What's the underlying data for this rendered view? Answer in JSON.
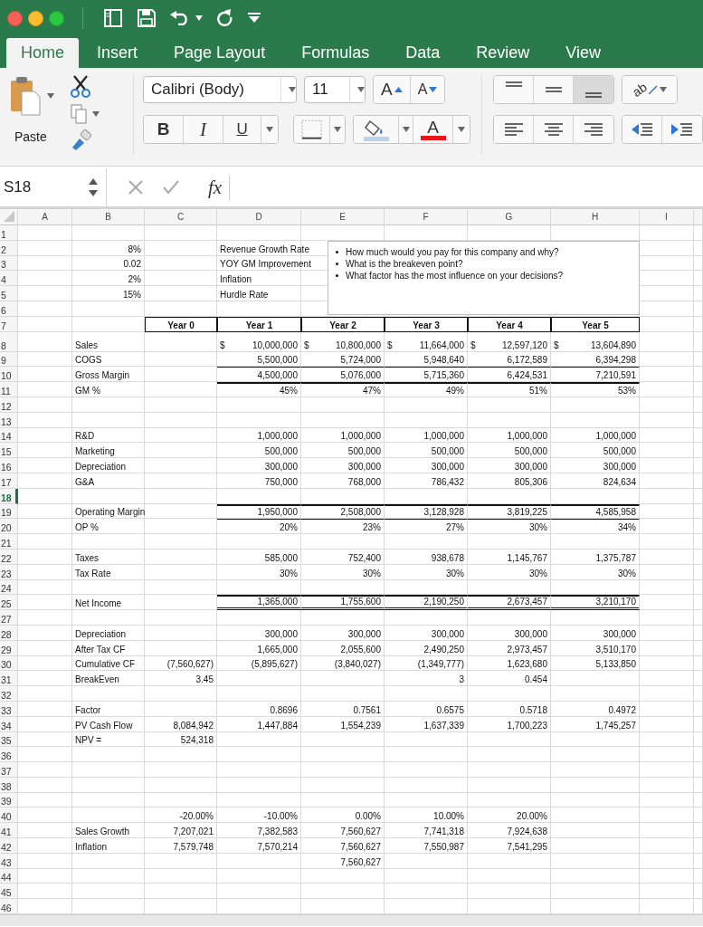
{
  "tabs": [
    {
      "label": "Home",
      "selected": true
    },
    {
      "label": "Insert",
      "selected": false
    },
    {
      "label": "Page Layout",
      "selected": false
    },
    {
      "label": "Formulas",
      "selected": false
    },
    {
      "label": "Data",
      "selected": false
    },
    {
      "label": "Review",
      "selected": false
    },
    {
      "label": "View",
      "selected": false
    }
  ],
  "ribbon": {
    "paste_label": "Paste",
    "font_name": "Calibri (Body)",
    "font_size": "11",
    "grow_font": "A",
    "shrink_font": "A",
    "bold": "B",
    "italic": "I",
    "underline": "U",
    "font_color": "A",
    "orientation": "ab",
    "vertical_alignment": [
      {
        "selected": false
      },
      {
        "selected": false
      },
      {
        "selected": true
      }
    ]
  },
  "formula_bar": {
    "name_box": "S18",
    "function_label": "fx"
  },
  "sheet": {
    "columns": [
      "A",
      "B",
      "C",
      "D",
      "E",
      "F",
      "G",
      "H",
      "I"
    ],
    "text_box": {
      "bullets": [
        "How much would you pay for this company and why?",
        "What is the breakeven point?",
        "What factor has the most influence on your decisions?"
      ]
    },
    "rows": [
      {
        "number": "1",
        "selected": false
      },
      {
        "number": "2",
        "selected": false,
        "cells": [
          null,
          {
            "kind": "number",
            "text": "8%"
          },
          null,
          {
            "kind": "label",
            "text": "Revenue Growth Rate"
          }
        ]
      },
      {
        "number": "3",
        "selected": false,
        "cells": [
          null,
          {
            "kind": "number",
            "text": "0.02"
          },
          null,
          {
            "kind": "label",
            "text": "YOY GM Improvement"
          }
        ]
      },
      {
        "number": "4",
        "selected": false,
        "cells": [
          null,
          {
            "kind": "number",
            "text": "2%"
          },
          null,
          {
            "kind": "label",
            "text": "Inflation"
          }
        ]
      },
      {
        "number": "5",
        "selected": false,
        "cells": [
          null,
          {
            "kind": "number",
            "text": "15%"
          },
          null,
          {
            "kind": "label",
            "text": "Hurdle Rate"
          }
        ]
      },
      {
        "number": "6",
        "selected": false
      },
      {
        "number": "7",
        "selected": false,
        "cells": [
          null,
          null,
          {
            "kind": "header",
            "text": "Year 0"
          },
          {
            "kind": "header",
            "text": "Year 1"
          },
          {
            "kind": "header",
            "text": "Year 2"
          },
          {
            "kind": "header",
            "text": "Year 3"
          },
          {
            "kind": "header",
            "text": "Year 4"
          },
          {
            "kind": "header",
            "text": "Year 5"
          }
        ]
      },
      {
        "number": "8",
        "selected": false,
        "tall": true,
        "cells": [
          null,
          {
            "kind": "label",
            "text": "Sales"
          },
          null,
          {
            "kind": "currency",
            "symbol": "$",
            "text": "10,000,000"
          },
          {
            "kind": "currency",
            "symbol": "$",
            "text": "10,800,000"
          },
          {
            "kind": "currency",
            "symbol": "$",
            "text": "11,664,000"
          },
          {
            "kind": "currency",
            "symbol": "$",
            "text": "12,597,120"
          },
          {
            "kind": "currency",
            "symbol": "$",
            "text": "13,604,890"
          }
        ]
      },
      {
        "number": "9",
        "selected": false,
        "cells": [
          null,
          {
            "kind": "label",
            "text": "COGS"
          },
          null,
          {
            "kind": "number",
            "text": "5,500,000"
          },
          {
            "kind": "number",
            "text": "5,724,000"
          },
          {
            "kind": "number",
            "text": "5,948,640"
          },
          {
            "kind": "number",
            "text": "6,172,589"
          },
          {
            "kind": "number",
            "text": "6,394,298"
          }
        ]
      },
      {
        "number": "10",
        "selected": false,
        "top_rule": true,
        "cells": [
          null,
          {
            "kind": "label",
            "text": "Gross Margin"
          },
          null,
          {
            "kind": "number",
            "text": "4,500,000"
          },
          {
            "kind": "number",
            "text": "5,076,000"
          },
          {
            "kind": "number",
            "text": "5,715,360"
          },
          {
            "kind": "number",
            "text": "6,424,531"
          },
          {
            "kind": "number",
            "text": "7,210,591"
          }
        ]
      },
      {
        "number": "11",
        "selected": false,
        "top_rule": true,
        "top_rule_thick": true,
        "cells": [
          null,
          {
            "kind": "label",
            "text": "GM %"
          },
          null,
          {
            "kind": "number",
            "text": "45%"
          },
          {
            "kind": "number",
            "text": "47%"
          },
          {
            "kind": "number",
            "text": "49%"
          },
          {
            "kind": "number",
            "text": "51%"
          },
          {
            "kind": "number",
            "text": "53%"
          }
        ]
      },
      {
        "number": "12",
        "selected": false
      },
      {
        "number": "13",
        "selected": false
      },
      {
        "number": "14",
        "selected": false,
        "cells": [
          null,
          {
            "kind": "label",
            "text": "R&D"
          },
          null,
          {
            "kind": "number",
            "text": "1,000,000"
          },
          {
            "kind": "number",
            "text": "1,000,000"
          },
          {
            "kind": "number",
            "text": "1,000,000"
          },
          {
            "kind": "number",
            "text": "1,000,000"
          },
          {
            "kind": "number",
            "text": "1,000,000"
          }
        ]
      },
      {
        "number": "15",
        "selected": false,
        "cells": [
          null,
          {
            "kind": "label",
            "text": "Marketing"
          },
          null,
          {
            "kind": "number",
            "text": "500,000"
          },
          {
            "kind": "number",
            "text": "500,000"
          },
          {
            "kind": "number",
            "text": "500,000"
          },
          {
            "kind": "number",
            "text": "500,000"
          },
          {
            "kind": "number",
            "text": "500,000"
          }
        ]
      },
      {
        "number": "16",
        "selected": false,
        "cells": [
          null,
          {
            "kind": "label",
            "text": "Depreciation"
          },
          null,
          {
            "kind": "number",
            "text": "300,000"
          },
          {
            "kind": "number",
            "text": "300,000"
          },
          {
            "kind": "number",
            "text": "300,000"
          },
          {
            "kind": "number",
            "text": "300,000"
          },
          {
            "kind": "number",
            "text": "300,000"
          }
        ]
      },
      {
        "number": "17",
        "selected": false,
        "cells": [
          null,
          {
            "kind": "label",
            "text": "G&A"
          },
          null,
          {
            "kind": "number",
            "text": "750,000"
          },
          {
            "kind": "number",
            "text": "768,000"
          },
          {
            "kind": "number",
            "text": "786,432"
          },
          {
            "kind": "number",
            "text": "805,306"
          },
          {
            "kind": "number",
            "text": "824,634"
          }
        ]
      },
      {
        "number": "18",
        "selected": true
      },
      {
        "number": "19",
        "selected": false,
        "top_rule": true,
        "top_rule_thick": true,
        "cells": [
          null,
          {
            "kind": "label",
            "text": "Operating Margin"
          },
          null,
          {
            "kind": "number",
            "text": "1,950,000"
          },
          {
            "kind": "number",
            "text": "2,508,000"
          },
          {
            "kind": "number",
            "text": "3,128,928"
          },
          {
            "kind": "number",
            "text": "3,819,225"
          },
          {
            "kind": "number",
            "text": "4,585,958"
          }
        ]
      },
      {
        "number": "20",
        "selected": false,
        "top_rule": true,
        "cells": [
          null,
          {
            "kind": "label",
            "text": "OP %"
          },
          null,
          {
            "kind": "number",
            "text": "20%"
          },
          {
            "kind": "number",
            "text": "23%"
          },
          {
            "kind": "number",
            "text": "27%"
          },
          {
            "kind": "number",
            "text": "30%"
          },
          {
            "kind": "number",
            "text": "34%"
          }
        ]
      },
      {
        "number": "21",
        "selected": false
      },
      {
        "number": "22",
        "selected": false,
        "cells": [
          null,
          {
            "kind": "label",
            "text": "Taxes"
          },
          null,
          {
            "kind": "number",
            "text": "585,000"
          },
          {
            "kind": "number",
            "text": "752,400"
          },
          {
            "kind": "number",
            "text": "938,678"
          },
          {
            "kind": "number",
            "text": "1,145,767"
          },
          {
            "kind": "number",
            "text": "1,375,787"
          }
        ]
      },
      {
        "number": "23",
        "selected": false,
        "cells": [
          null,
          {
            "kind": "label",
            "text": "Tax Rate"
          },
          null,
          {
            "kind": "number",
            "text": "30%"
          },
          {
            "kind": "number",
            "text": "30%"
          },
          {
            "kind": "number",
            "text": "30%"
          },
          {
            "kind": "number",
            "text": "30%"
          },
          {
            "kind": "number",
            "text": "30%"
          }
        ]
      },
      {
        "number": "24",
        "selected": false
      },
      {
        "number": "25",
        "selected": false,
        "top_rule": true,
        "top_rule_thick": true,
        "double_underline": true,
        "cells": [
          null,
          {
            "kind": "label",
            "text": "Net Income"
          },
          null,
          {
            "kind": "number",
            "text": "1,365,000"
          },
          {
            "kind": "number",
            "text": "1,755,600"
          },
          {
            "kind": "number",
            "text": "2,190,250"
          },
          {
            "kind": "number",
            "text": "2,673,457"
          },
          {
            "kind": "number",
            "text": "3,210,170"
          }
        ]
      },
      {
        "number": "27",
        "selected": false
      },
      {
        "number": "28",
        "selected": false,
        "cells": [
          null,
          {
            "kind": "label",
            "text": "Depreciation"
          },
          null,
          {
            "kind": "number",
            "text": "300,000"
          },
          {
            "kind": "number",
            "text": "300,000"
          },
          {
            "kind": "number",
            "text": "300,000"
          },
          {
            "kind": "number",
            "text": "300,000"
          },
          {
            "kind": "number",
            "text": "300,000"
          }
        ]
      },
      {
        "number": "29",
        "selected": false,
        "cells": [
          null,
          {
            "kind": "label",
            "text": "After Tax CF"
          },
          null,
          {
            "kind": "number",
            "text": "1,665,000"
          },
          {
            "kind": "number",
            "text": "2,055,600"
          },
          {
            "kind": "number",
            "text": "2,490,250"
          },
          {
            "kind": "number",
            "text": "2,973,457"
          },
          {
            "kind": "number",
            "text": "3,510,170"
          }
        ]
      },
      {
        "number": "30",
        "selected": false,
        "cells": [
          null,
          {
            "kind": "label",
            "text": "Cumulative CF"
          },
          {
            "kind": "number",
            "text": "(7,560,627)"
          },
          {
            "kind": "number",
            "text": "(5,895,627)"
          },
          {
            "kind": "number",
            "text": "(3,840,027)"
          },
          {
            "kind": "number",
            "text": "(1,349,777)"
          },
          {
            "kind": "number",
            "text": "1,623,680"
          },
          {
            "kind": "number",
            "text": "5,133,850"
          }
        ]
      },
      {
        "number": "31",
        "selected": false,
        "cells": [
          null,
          {
            "kind": "label",
            "text": "BreakEven"
          },
          {
            "kind": "number",
            "text": "3.45"
          },
          null,
          null,
          {
            "kind": "number",
            "text": "3"
          },
          {
            "kind": "number",
            "text": "0.454"
          }
        ]
      },
      {
        "number": "32",
        "selected": false
      },
      {
        "number": "33",
        "selected": false,
        "cells": [
          null,
          {
            "kind": "label",
            "text": "Factor"
          },
          null,
          {
            "kind": "number",
            "text": "0.8696"
          },
          {
            "kind": "number",
            "text": "0.7561"
          },
          {
            "kind": "number",
            "text": "0.6575"
          },
          {
            "kind": "number",
            "text": "0.5718"
          },
          {
            "kind": "number",
            "text": "0.4972"
          }
        ]
      },
      {
        "number": "34",
        "selected": false,
        "cells": [
          null,
          {
            "kind": "label",
            "text": "PV Cash Flow"
          },
          {
            "kind": "number",
            "text": "8,084,942"
          },
          {
            "kind": "number",
            "text": "1,447,884"
          },
          {
            "kind": "number",
            "text": "1,554,239"
          },
          {
            "kind": "number",
            "text": "1,637,339"
          },
          {
            "kind": "number",
            "text": "1,700,223"
          },
          {
            "kind": "number",
            "text": "1,745,257"
          }
        ]
      },
      {
        "number": "35",
        "selected": false,
        "cells": [
          null,
          {
            "kind": "label",
            "text": "NPV ="
          },
          {
            "kind": "number",
            "text": "524,318"
          }
        ]
      },
      {
        "number": "36",
        "selected": false
      },
      {
        "number": "37",
        "selected": false
      },
      {
        "number": "38",
        "selected": false
      },
      {
        "number": "39",
        "selected": false
      },
      {
        "number": "40",
        "selected": false,
        "cells": [
          null,
          null,
          {
            "kind": "number",
            "text": "-20.00%"
          },
          {
            "kind": "number",
            "text": "-10.00%"
          },
          {
            "kind": "number",
            "text": "0.00%"
          },
          {
            "kind": "number",
            "text": "10.00%"
          },
          {
            "kind": "number",
            "text": "20.00%"
          }
        ]
      },
      {
        "number": "41",
        "selected": false,
        "cells": [
          null,
          {
            "kind": "label",
            "text": "Sales Growth"
          },
          {
            "kind": "number",
            "text": "7,207,021"
          },
          {
            "kind": "number",
            "text": "7,382,583"
          },
          {
            "kind": "number",
            "text": "7,560,627"
          },
          {
            "kind": "number",
            "text": "7,741,318"
          },
          {
            "kind": "number",
            "text": "7,924,638"
          }
        ]
      },
      {
        "number": "42",
        "selected": false,
        "cells": [
          null,
          {
            "kind": "label",
            "text": "Inflation"
          },
          {
            "kind": "number",
            "text": "7,579,748"
          },
          {
            "kind": "number",
            "text": "7,570,214"
          },
          {
            "kind": "number",
            "text": "7,560,627"
          },
          {
            "kind": "number",
            "text": "7,550,987"
          },
          {
            "kind": "number",
            "text": "7,541,295"
          }
        ]
      },
      {
        "number": "43",
        "selected": false,
        "cells": [
          null,
          null,
          null,
          null,
          {
            "kind": "number",
            "text": "7,560,627"
          }
        ]
      },
      {
        "number": "44",
        "selected": false
      },
      {
        "number": "45",
        "selected": false
      },
      {
        "number": "46",
        "selected": false
      }
    ]
  }
}
